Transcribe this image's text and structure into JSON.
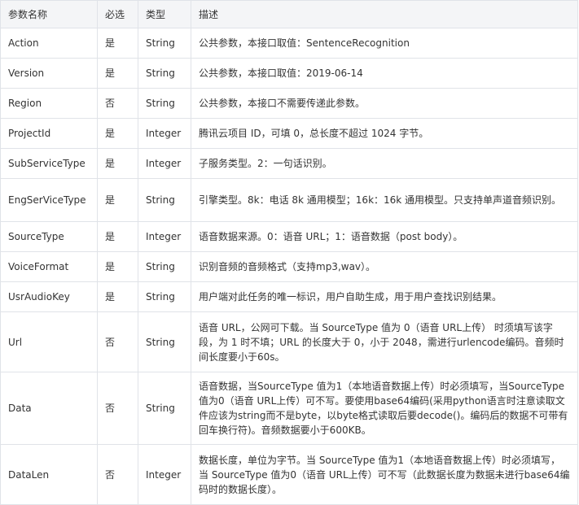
{
  "table": {
    "headers": [
      "参数名称",
      "必选",
      "类型",
      "描述"
    ],
    "rows": [
      {
        "name": "Action",
        "required": "是",
        "type": "String",
        "desc": "公共参数，本接口取值：SentenceRecognition"
      },
      {
        "name": "Version",
        "required": "是",
        "type": "String",
        "desc": "公共参数，本接口取值：2019-06-14"
      },
      {
        "name": "Region",
        "required": "否",
        "type": "String",
        "desc": "公共参数，本接口不需要传递此参数。"
      },
      {
        "name": "ProjectId",
        "required": "是",
        "type": "Integer",
        "desc": "腾讯云项目 ID，可填 0，总长度不超过 1024 字节。"
      },
      {
        "name": "SubServiceType",
        "required": "是",
        "type": "Integer",
        "desc": "子服务类型。2：一句话识别。"
      },
      {
        "name": "EngSerViceType",
        "required": "是",
        "type": "String",
        "desc": "引擎类型。8k：电话 8k 通用模型；16k：16k 通用模型。只支持单声道音频识别。"
      },
      {
        "name": "SourceType",
        "required": "是",
        "type": "Integer",
        "desc": "语音数据来源。0：语音 URL；1：语音数据（post body）。"
      },
      {
        "name": "VoiceFormat",
        "required": "是",
        "type": "String",
        "desc": "识别音频的音频格式（支持mp3,wav）。"
      },
      {
        "name": "UsrAudioKey",
        "required": "是",
        "type": "String",
        "desc": "用户端对此任务的唯一标识，用户自助生成，用于用户查找识别结果。"
      },
      {
        "name": "Url",
        "required": "否",
        "type": "String",
        "desc": "语音 URL，公网可下载。当 SourceType 值为 0（语音 URL上传） 时须填写该字段，为 1 时不填；URL 的长度大于 0，小于 2048，需进行urlencode编码。音频时间长度要小于60s。"
      },
      {
        "name": "Data",
        "required": "否",
        "type": "String",
        "desc": "语音数据，当SourceType 值为1（本地语音数据上传）时必须填写，当SourceType 值为0（语音 URL上传）可不写。要使用base64编码(采用python语言时注意读取文件应该为string而不是byte，以byte格式读取后要decode()。编码后的数据不可带有回车换行符)。音频数据要小于600KB。"
      },
      {
        "name": "DataLen",
        "required": "否",
        "type": "Integer",
        "desc": "数据长度，单位为字节。当 SourceType 值为1（本地语音数据上传）时必须填写，当 SourceType 值为0（语音 URL上传）可不写（此数据长度为数据未进行base64编码时的数据长度）。"
      }
    ]
  }
}
